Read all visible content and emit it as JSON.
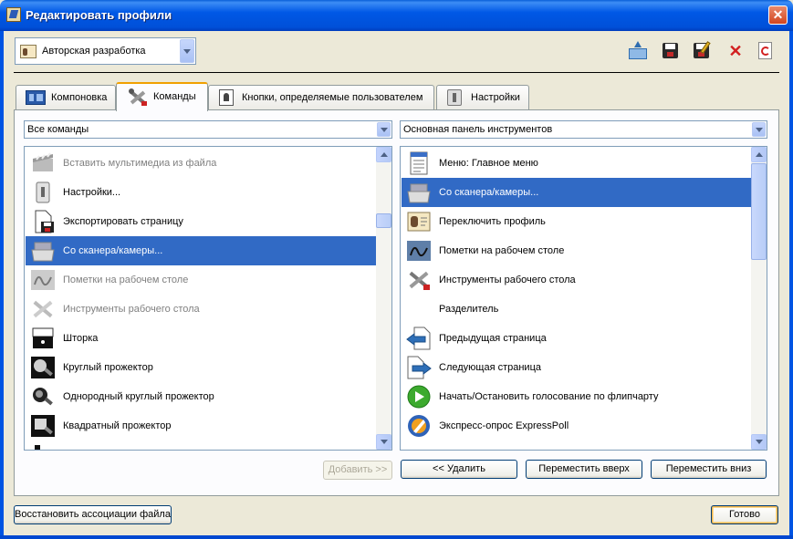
{
  "window": {
    "title": "Редактировать профили"
  },
  "profile": {
    "selected": "Авторская разработка"
  },
  "toolbar": {
    "icons": [
      "import-icon",
      "save-icon",
      "save-as-icon",
      "delete-icon",
      "refresh-icon"
    ]
  },
  "tabs": [
    {
      "label": "Компоновка",
      "icon": "layout-icon"
    },
    {
      "label": "Команды",
      "icon": "tools-icon"
    },
    {
      "label": "Кнопки, определяемые пользователем",
      "icon": "user-button-icon"
    },
    {
      "label": "Настройки",
      "icon": "settings-icon"
    }
  ],
  "commands": {
    "filter": "Все команды",
    "items": [
      {
        "label": "Вставить мультимедиа из файла",
        "icon": "clapperboard-icon",
        "disabled": true
      },
      {
        "label": "Настройки...",
        "icon": "settings-icon",
        "disabled": false
      },
      {
        "label": "Экспортировать страницу",
        "icon": "export-page-icon",
        "disabled": false
      },
      {
        "label": "Со сканера/камеры...",
        "icon": "scanner-icon",
        "selected": true
      },
      {
        "label": "Пометки на рабочем столе",
        "icon": "desktop-annotate-icon",
        "disabled": true
      },
      {
        "label": "Инструменты рабочего стола",
        "icon": "desktop-tools-icon",
        "disabled": true
      },
      {
        "label": "Шторка",
        "icon": "blind-icon",
        "disabled": false
      },
      {
        "label": "Круглый прожектор",
        "icon": "spotlight-round-icon",
        "disabled": false
      },
      {
        "label": "Однородный круглый прожектор",
        "icon": "spotlight-solid-icon",
        "disabled": false
      },
      {
        "label": "Квадратный прожектор",
        "icon": "spotlight-square-icon",
        "disabled": false
      },
      {
        "label": "",
        "icon": "partial-icon",
        "disabled": false
      }
    ]
  },
  "toolbar_panel": {
    "filter": "Основная панель инструментов",
    "items": [
      {
        "label": "Меню: Главное меню",
        "icon": "menu-icon"
      },
      {
        "label": "Со сканера/камеры...",
        "icon": "scanner-icon",
        "selected": true
      },
      {
        "label": "Переключить профиль",
        "icon": "profile-icon"
      },
      {
        "label": "Пометки на рабочем столе",
        "icon": "desktop-annotate-icon"
      },
      {
        "label": "Инструменты рабочего стола",
        "icon": "desktop-tools-icon"
      },
      {
        "label": "Разделитель",
        "icon": ""
      },
      {
        "label": "Предыдущая страница",
        "icon": "prev-page-icon"
      },
      {
        "label": "Следующая страница",
        "icon": "next-page-icon"
      },
      {
        "label": "Начать/Остановить голосование по флипчарту",
        "icon": "play-vote-icon"
      },
      {
        "label": "Экспресс-опрос ExpressPoll",
        "icon": "expresspoll-icon"
      }
    ]
  },
  "buttons": {
    "add": "Добавить >>",
    "remove": "<< Удалить",
    "move_up": "Переместить вверх",
    "move_down": "Переместить вниз",
    "restore": "Восстановить ассоциации файла",
    "done": "Готово"
  },
  "colors": {
    "selection": "#316ac5",
    "title_bar": "#0054e3",
    "tab_accent": "#f0a000"
  }
}
